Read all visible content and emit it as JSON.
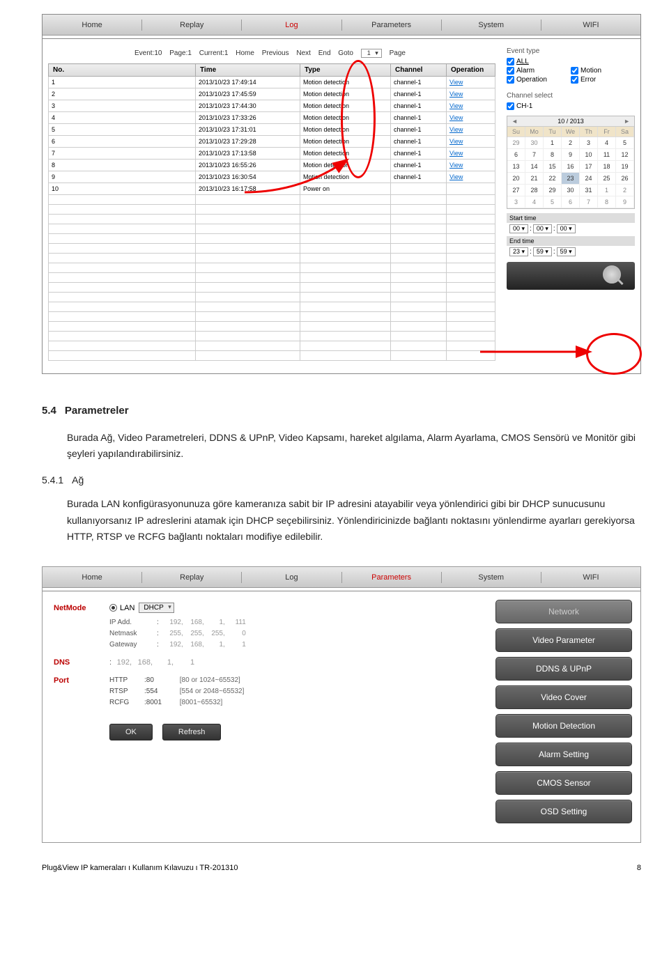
{
  "nav": {
    "tabs": [
      "Home",
      "Replay",
      "Log",
      "Parameters",
      "System",
      "WIFI"
    ],
    "log_active": 2,
    "param_active": 3
  },
  "status": {
    "event": "Event:10",
    "page": "Page:1",
    "current": "Current:1",
    "home": "Home",
    "previous": "Previous",
    "next": "Next",
    "end": "End",
    "goto": "Goto",
    "goto_val": "1",
    "page_lbl": "Page"
  },
  "log_headers": [
    "No.",
    "Time",
    "Type",
    "Channel",
    "Operation"
  ],
  "log_rows": [
    [
      "1",
      "2013/10/23 17:49:14",
      "Motion detection",
      "channel-1",
      "View"
    ],
    [
      "2",
      "2013/10/23 17:45:59",
      "Motion detection",
      "channel-1",
      "View"
    ],
    [
      "3",
      "2013/10/23 17:44:30",
      "Motion detection",
      "channel-1",
      "View"
    ],
    [
      "4",
      "2013/10/23 17:33:26",
      "Motion detection",
      "channel-1",
      "View"
    ],
    [
      "5",
      "2013/10/23 17:31:01",
      "Motion detection",
      "channel-1",
      "View"
    ],
    [
      "6",
      "2013/10/23 17:29:28",
      "Motion detection",
      "channel-1",
      "View"
    ],
    [
      "7",
      "2013/10/23 17:13:58",
      "Motion detection",
      "channel-1",
      "View"
    ],
    [
      "8",
      "2013/10/23 16:55:26",
      "Motion detection",
      "channel-1",
      "View"
    ],
    [
      "9",
      "2013/10/23 16:30:54",
      "Motion detection",
      "channel-1",
      "View"
    ],
    [
      "10",
      "2013/10/23 16:17:58",
      "Power on",
      "",
      ""
    ]
  ],
  "filters": {
    "event_type": "Event type",
    "all": "ALL",
    "alarm": "Alarm",
    "motion": "Motion",
    "operation": "Operation",
    "error": "Error",
    "channel_select": "Channel select",
    "ch1": "CH-1"
  },
  "calendar": {
    "title": "10 / 2013",
    "days": [
      "Su",
      "Mo",
      "Tu",
      "We",
      "Th",
      "Fr",
      "Sa"
    ],
    "cells": [
      [
        "29",
        "30",
        "1",
        "2",
        "3",
        "4",
        "5"
      ],
      [
        "6",
        "7",
        "8",
        "9",
        "10",
        "11",
        "12"
      ],
      [
        "13",
        "14",
        "15",
        "16",
        "17",
        "18",
        "19"
      ],
      [
        "20",
        "21",
        "22",
        "23",
        "24",
        "25",
        "26"
      ],
      [
        "27",
        "28",
        "29",
        "30",
        "31",
        "1",
        "2"
      ],
      [
        "3",
        "4",
        "5",
        "6",
        "7",
        "8",
        "9"
      ]
    ],
    "selected": "23"
  },
  "time": {
    "start": "Start time",
    "end": "End time",
    "s1": "00",
    "s2": "00",
    "s3": "00",
    "e1": "23",
    "e2": "59",
    "e3": "59"
  },
  "doc": {
    "h1_num": "5.4",
    "h1": "Parametreler",
    "p1": "Burada Ağ, Video Parametreleri, DDNS & UPnP, Video Kapsamı, hareket algılama, Alarm Ayarlama, CMOS Sensörü ve Monitör gibi şeyleri yapılandırabilirsiniz.",
    "h2_num": "5.4.1",
    "h2": "Ağ",
    "p2": "Burada LAN konfigürasyonunuza göre kameranıza sabit bir IP adresini atayabilir veya yönlendirici gibi bir DHCP sunucusunu kullanıyorsanız IP adreslerini atamak için DHCP seçebilirsiniz. Yönlendiricinizde bağlantı noktasını yönlendirme ayarları gerekiyorsa HTTP, RTSP ve RCFG bağlantı noktaları modifiye edilebilir."
  },
  "net": {
    "label": "NetMode",
    "lan": "LAN",
    "dhcp": "DHCP",
    "ip": "IP Add.",
    "netmask": "Netmask",
    "gateway": "Gateway",
    "ip_v": [
      "192,",
      "168,",
      "1,",
      "111"
    ],
    "nm_v": [
      "255,",
      "255,",
      "255,",
      "0"
    ],
    "gw_v": [
      "192,",
      "168,",
      "1,",
      "1"
    ]
  },
  "dns": {
    "label": "DNS",
    "v": [
      "192,",
      "168,",
      "1,",
      "1"
    ]
  },
  "port": {
    "label": "Port",
    "http": "HTTP",
    "http_v": "80",
    "http_h": "[80 or 1024~65532]",
    "rtsp": "RTSP",
    "rtsp_v": "554",
    "rtsp_h": "[554 or 2048~65532]",
    "rcfg": "RCFG",
    "rcfg_v": "8001",
    "rcfg_h": "[8001~65532]"
  },
  "btns": {
    "ok": "OK",
    "refresh": "Refresh"
  },
  "side": [
    "Network",
    "Video Parameter",
    "DDNS & UPnP",
    "Video Cover",
    "Motion Detection",
    "Alarm Setting",
    "CMOS Sensor",
    "OSD Setting"
  ],
  "footer": {
    "left": "Plug&View IP kameraları ι Kullanım Kılavuzu ι TR-201310",
    "right": "8"
  }
}
